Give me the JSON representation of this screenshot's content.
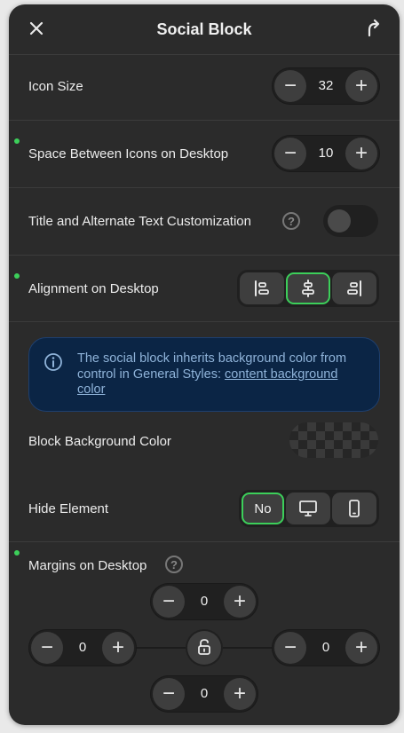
{
  "header": {
    "title": "Social Block"
  },
  "icon_size": {
    "label": "Icon Size",
    "value": "32"
  },
  "space_between": {
    "label": "Space Between Icons on Desktop",
    "value": "10"
  },
  "title_alt": {
    "label": "Title and Alternate Text Customization",
    "help": "?",
    "enabled": false
  },
  "alignment": {
    "label": "Alignment on Desktop",
    "options": [
      "left",
      "center",
      "right"
    ],
    "selected": "center"
  },
  "info": {
    "text": "The social block inherits background color from control in General Styles: ",
    "link": "content background color"
  },
  "block_bg": {
    "label": "Block Background Color"
  },
  "hide_element": {
    "label": "Hide Element",
    "no_label": "No"
  },
  "margins": {
    "label": "Margins on Desktop",
    "help": "?",
    "top": "0",
    "left": "0",
    "right": "0",
    "bottom": "0"
  },
  "colors": {
    "panel": "#2b2b2b",
    "accent_green": "#3ccf5a",
    "info_bg": "#0b2545",
    "info_text": "#8fb3d9"
  },
  "stepper": {
    "minus": "−",
    "plus": "+"
  }
}
